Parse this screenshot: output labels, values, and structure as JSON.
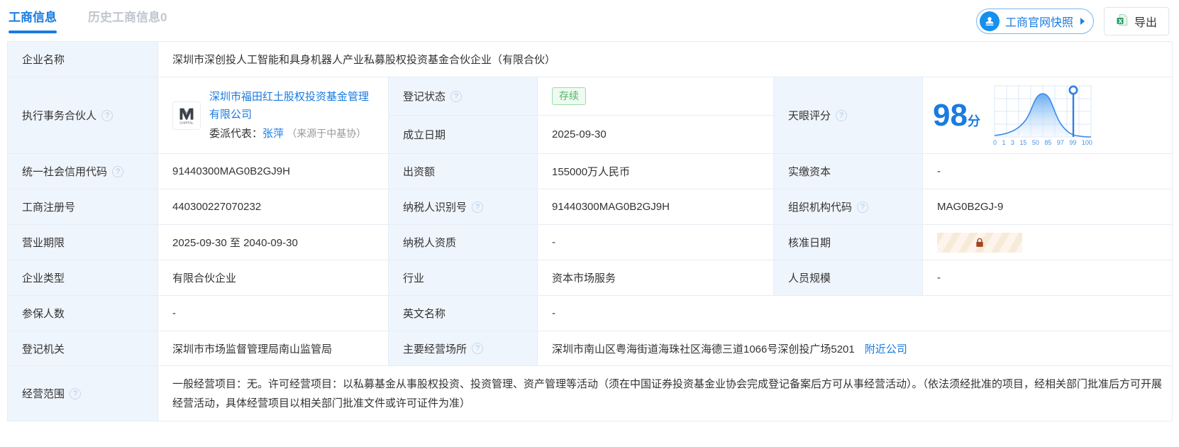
{
  "tabs": {
    "business": "工商信息",
    "history": "历史工商信息0"
  },
  "toolbar": {
    "snapshot_label": "工商官网快照",
    "export_label": "导出"
  },
  "fields": {
    "company_name": {
      "label": "企业名称",
      "value": "深圳市深创投人工智能和具身机器人产业私募股权投资基金合伙企业（有限合伙）"
    },
    "executive_partner": {
      "label": "执行事务合伙人",
      "company": "深圳市福田红土股权投资基金管理有限公司",
      "rep_label": "委派代表：",
      "rep_name": "张萍",
      "rep_source": "（来源于中基协）",
      "logo_text": "CAPITAL"
    },
    "reg_status": {
      "label": "登记状态",
      "value": "存续"
    },
    "establish_date": {
      "label": "成立日期",
      "value": "2025-09-30"
    },
    "tianyan_score": {
      "label": "天眼评分",
      "score": "98",
      "unit": "分"
    },
    "credit_code": {
      "label": "统一社会信用代码",
      "value": "91440300MAG0B2GJ9H"
    },
    "capital": {
      "label": "出资额",
      "value": "155000万人民币"
    },
    "paid_capital": {
      "label": "实缴资本",
      "value": "-"
    },
    "reg_number": {
      "label": "工商注册号",
      "value": "440300227070232"
    },
    "taxpayer_id": {
      "label": "纳税人识别号",
      "value": "91440300MAG0B2GJ9H"
    },
    "org_code": {
      "label": "组织机构代码",
      "value": "MAG0B2GJ-9"
    },
    "business_term": {
      "label": "营业期限",
      "value": "2025-09-30 至 2040-09-30"
    },
    "taxpayer_qualification": {
      "label": "纳税人资质",
      "value": "-"
    },
    "approval_date": {
      "label": "核准日期"
    },
    "company_type": {
      "label": "企业类型",
      "value": "有限合伙企业"
    },
    "industry": {
      "label": "行业",
      "value": "资本市场服务"
    },
    "staff_size": {
      "label": "人员规模",
      "value": "-"
    },
    "insured_count": {
      "label": "参保人数",
      "value": "-"
    },
    "english_name": {
      "label": "英文名称",
      "value": "-"
    },
    "reg_authority": {
      "label": "登记机关",
      "value": "深圳市市场监督管理局南山监管局"
    },
    "business_address": {
      "label": "主要经营场所",
      "value": "深圳市南山区粤海街道海珠社区海德三道1066号深创投广场5201",
      "nearby_link": "附近公司"
    },
    "business_scope": {
      "label": "经营范围",
      "value": "一般经营项目：无。许可经营项目：以私募基金从事股权投资、投资管理、资产管理等活动（须在中国证券投资基金业协会完成登记备案后方可从事经营活动）。（依法须经批准的项目，经相关部门批准后方可开展经营活动，具体经营项目以相关部门批准文件或许可证件为准）"
    }
  },
  "chart_data": {
    "type": "area",
    "title": "天眼评分分布",
    "x_ticks": [
      "0",
      "1",
      "3",
      "15",
      "50",
      "85",
      "97",
      "99",
      "100"
    ],
    "marker_value": 98,
    "score": 98,
    "curve": "bell-shaped distribution peaking at tick 50, marker pin at 98",
    "grid": true
  },
  "colors": {
    "accent_blue": "#1b7be0",
    "status_green": "#4fb567",
    "lock_brown": "#a5431f",
    "label_bg": "#eff5fc",
    "border": "#e7edf4"
  }
}
